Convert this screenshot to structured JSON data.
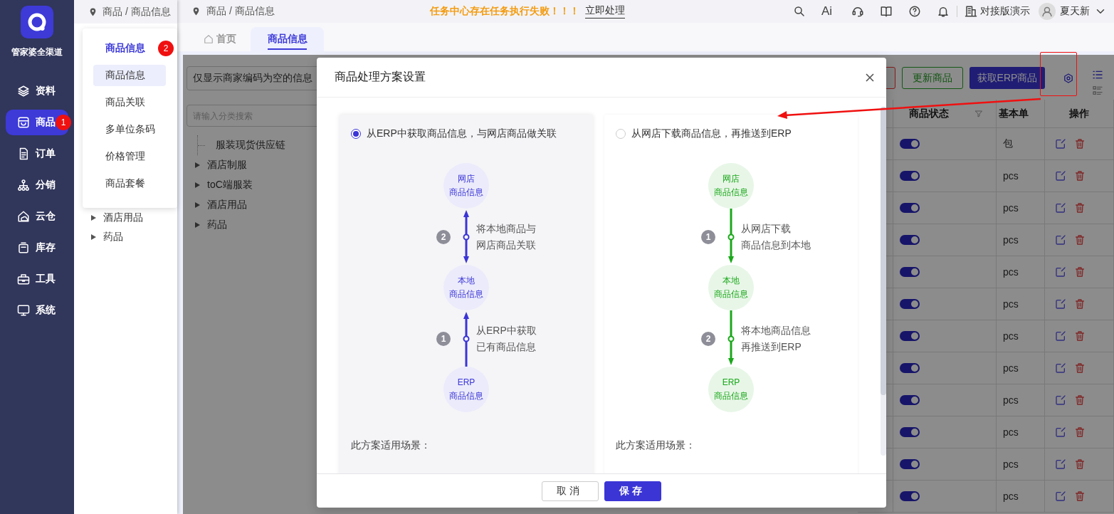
{
  "nav": {
    "logo_text": "管家婆全渠道",
    "items": [
      {
        "label": "资料",
        "selected": false
      },
      {
        "label": "商品",
        "selected": true,
        "badge": "1"
      },
      {
        "label": "订单",
        "selected": false
      },
      {
        "label": "分销",
        "selected": false
      },
      {
        "label": "云仓",
        "selected": false
      },
      {
        "label": "库存",
        "selected": false
      },
      {
        "label": "工具",
        "selected": false
      },
      {
        "label": "系统",
        "selected": false
      }
    ]
  },
  "sub_panel": {
    "breadcrumb": "商品 / 商品信息",
    "tree": [
      {
        "label": "酒店用品",
        "kind": "branch"
      },
      {
        "label": "药品",
        "kind": "branch"
      }
    ]
  },
  "flyout": {
    "title": "商品信息",
    "badge": "2",
    "items": [
      {
        "label": "商品信息",
        "selected": true
      },
      {
        "label": "商品关联",
        "selected": false
      },
      {
        "label": "多单位条码",
        "selected": false
      },
      {
        "label": "价格管理",
        "selected": false
      },
      {
        "label": "商品套餐",
        "selected": false
      }
    ]
  },
  "topbar": {
    "breadcrumb": "商品 / 商品信息",
    "alert": "任务中心存在任务执行失败！！！",
    "alert_link": "立即处理",
    "ai_label": "Ai",
    "account": "对接版演示",
    "user": "夏天新"
  },
  "tabs": [
    {
      "label": "首页",
      "selected": false,
      "kind": "home"
    },
    {
      "label": "商品信息",
      "selected": true,
      "kind": "page"
    }
  ],
  "filter_select": {
    "value": "仅显示商家编码为空的信息"
  },
  "category_search": {
    "placeholder": "请输入分类搜索"
  },
  "category_tree": [
    {
      "label": "服装现货供应链",
      "kind": "leaf"
    },
    {
      "label": "酒店制服",
      "kind": "branch"
    },
    {
      "label": "toC端服装",
      "kind": "branch"
    },
    {
      "label": "酒店用品",
      "kind": "branch"
    },
    {
      "label": "药品",
      "kind": "branch"
    }
  ],
  "toolbar": {
    "buttons": [
      {
        "kind": "danger"
      },
      {
        "label": "更新商品",
        "kind": "outline"
      },
      {
        "label": "获取ERP商品",
        "kind": "primary"
      }
    ]
  },
  "table": {
    "columns": [
      {
        "label": "商品状态",
        "filter": true
      },
      {
        "label": "基本单",
        "filter": false
      },
      {
        "label": "操作",
        "filter": false
      }
    ],
    "rows": [
      {
        "enabled": true,
        "unit": "包"
      },
      {
        "enabled": true,
        "unit": "pcs"
      },
      {
        "enabled": true,
        "unit": "pcs"
      },
      {
        "enabled": true,
        "unit": "pcs"
      },
      {
        "enabled": true,
        "unit": "pcs"
      },
      {
        "enabled": true,
        "unit": "pcs"
      },
      {
        "enabled": true,
        "unit": "pcs"
      },
      {
        "enabled": true,
        "unit": "pcs"
      },
      {
        "enabled": true,
        "unit": "pcs"
      },
      {
        "enabled": true,
        "unit": "pcs"
      },
      {
        "enabled": true,
        "unit": "pcs"
      },
      {
        "enabled": true,
        "unit": "pcs"
      }
    ]
  },
  "modal": {
    "title": "商品处理方案设置",
    "options": [
      {
        "label": "从ERP中获取商品信息，与网店商品做关联",
        "selected": true,
        "color": "#3b35d6",
        "nodes": [
          {
            "lines": [
              "网店",
              "商品信息"
            ]
          },
          {
            "lines": [
              "本地",
              "商品信息"
            ]
          },
          {
            "lines": [
              "ERP",
              "商品信息"
            ]
          }
        ],
        "links": [
          {
            "step": "2",
            "text": [
              "将本地商品与",
              "网店商品关联"
            ],
            "kind": "both"
          },
          {
            "step": "1",
            "text": [
              "从ERP中获取",
              "已有商品信息"
            ],
            "kind": "up"
          }
        ],
        "scenario_label": "此方案适用场景："
      },
      {
        "label": "从网店下载商品信息，再推送到ERP",
        "selected": false,
        "color": "#1aa81a",
        "nodes": [
          {
            "lines": [
              "网店",
              "商品信息"
            ]
          },
          {
            "lines": [
              "本地",
              "商品信息"
            ]
          },
          {
            "lines": [
              "ERP",
              "商品信息"
            ]
          }
        ],
        "links": [
          {
            "step": "1",
            "text": [
              "从网店下载",
              "商品信息到本地"
            ],
            "kind": "down"
          },
          {
            "step": "2",
            "text": [
              "将本地商品信息",
              "再推送到ERP"
            ],
            "kind": "down"
          }
        ],
        "scenario_label": "此方案适用场景："
      }
    ],
    "buttons": [
      {
        "label": "取消",
        "kind": "default"
      },
      {
        "label": "保存",
        "kind": "primary"
      }
    ]
  }
}
